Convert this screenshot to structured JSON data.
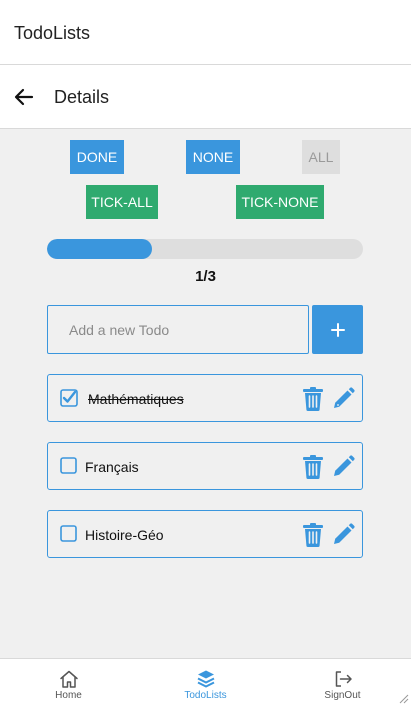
{
  "app": {
    "title": "TodoLists"
  },
  "header": {
    "title": "Details",
    "back_icon": "arrow-left-icon"
  },
  "filters": {
    "done": "DONE",
    "none": "NONE",
    "all": "ALL",
    "active": "all"
  },
  "bulk": {
    "tick_all": "TICK-ALL",
    "tick_none": "TICK-NONE"
  },
  "progress": {
    "completed": 1,
    "total": 3,
    "label": "1/3"
  },
  "add": {
    "placeholder": "Add a new Todo",
    "button_icon": "plus-icon"
  },
  "todos": [
    {
      "label": "Mathématiques",
      "done": true
    },
    {
      "label": "Français",
      "done": false
    },
    {
      "label": "Histoire-Géo",
      "done": false
    }
  ],
  "nav": {
    "items": [
      {
        "label": "Home",
        "icon": "home-icon"
      },
      {
        "label": "TodoLists",
        "icon": "layers-icon"
      },
      {
        "label": "SignOut",
        "icon": "sign-out-icon"
      }
    ],
    "active": 1
  },
  "colors": {
    "primary": "#3a96dd",
    "success": "#2faa6f",
    "disabled": "#dedede"
  }
}
